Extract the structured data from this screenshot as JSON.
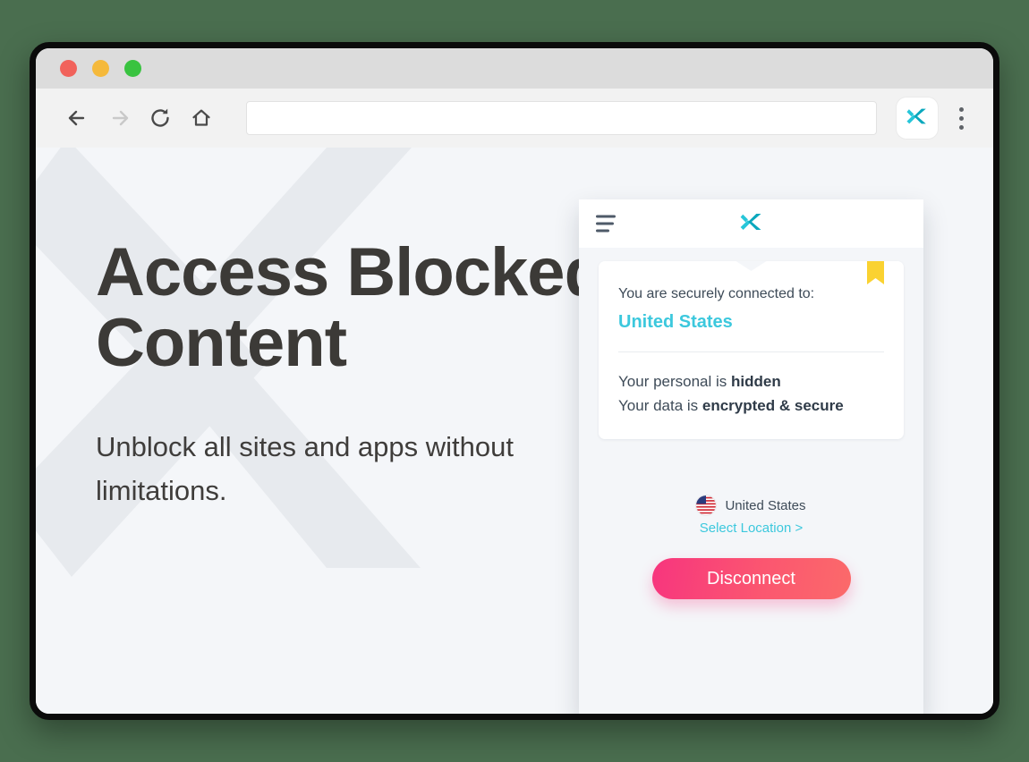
{
  "window": {
    "traffic_lights": [
      {
        "name": "close",
        "color": "#f1625b"
      },
      {
        "name": "minimize",
        "color": "#f5b93b"
      },
      {
        "name": "maximize",
        "color": "#39c340"
      }
    ]
  },
  "toolbar": {
    "back_icon": "arrow-left-icon",
    "forward_icon": "arrow-right-icon",
    "reload_icon": "reload-icon",
    "home_icon": "home-icon",
    "address_value": "",
    "address_placeholder": "",
    "extension_icon": "x-logo-icon",
    "menu_icon": "three-dot-menu-icon"
  },
  "page": {
    "title": "Access Blocked Content",
    "subtitle": "Unblock all sites and apps without limitations.",
    "background_color": "#f4f6f9",
    "watermark_icon": "x-watermark-icon"
  },
  "popup": {
    "header": {
      "menu_icon": "hamburger-menu-icon",
      "logo_icon": "x-logo-icon"
    },
    "status_card": {
      "connected_label": "You are securely connected to:",
      "country": "United States",
      "bookmark_icon": "bookmark-icon",
      "lines": [
        {
          "prefix": "Your personal is ",
          "strong": "hidden"
        },
        {
          "prefix": "Your data is ",
          "strong": "encrypted & secure"
        }
      ]
    },
    "footer": {
      "flag_icon": "us-flag-icon",
      "location_name": "United States",
      "select_location_label": "Select Location >",
      "disconnect_label": "Disconnect"
    },
    "colors": {
      "accent_teal": "#3cc8dd",
      "bookmark_yellow": "#fad231",
      "disconnect_gradient_start": "#f7357e",
      "disconnect_gradient_end": "#fb6a6a"
    }
  }
}
